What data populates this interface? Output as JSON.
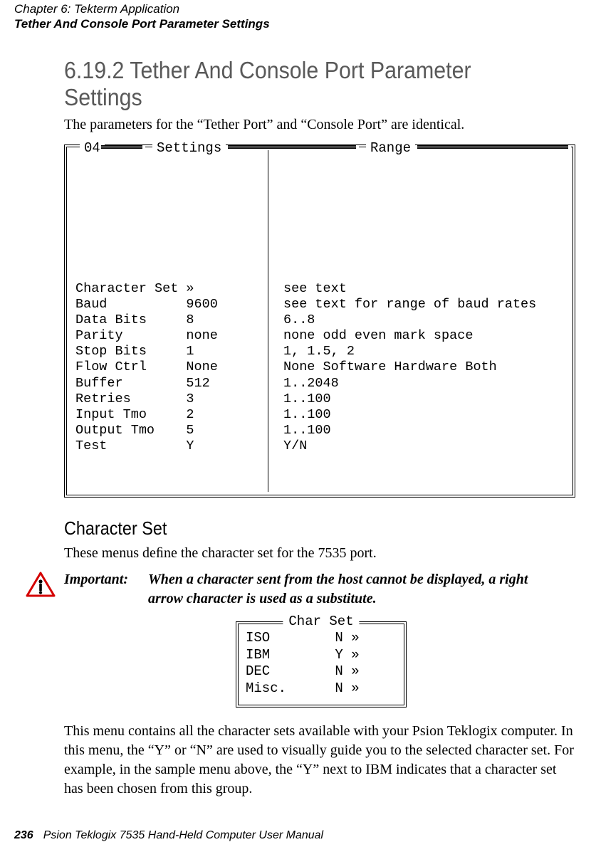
{
  "header": {
    "chapter": "Chapter 6: Tekterm Application",
    "section": "Tether And Console Port Parameter Settings"
  },
  "h2": "6.19.2  Tether And Console Port Parameter Settings",
  "intro": "The parameters for the “Tether Port” and “Console Port” are identical.",
  "settings": {
    "legend04": "04",
    "legendSettings": "Settings",
    "legendRange": "Range",
    "rows": [
      {
        "name": "Character Set",
        "value": "»",
        "range": "see text"
      },
      {
        "name": "Baud",
        "value": "9600",
        "range": "see text for range of baud rates"
      },
      {
        "name": "Data Bits",
        "value": "8",
        "range": "6..8"
      },
      {
        "name": "Parity",
        "value": "none",
        "range": "none odd even mark space"
      },
      {
        "name": "Stop Bits",
        "value": "1",
        "range": "1, 1.5, 2"
      },
      {
        "name": "Flow Ctrl",
        "value": "None",
        "range": "None Software Hardware Both"
      },
      {
        "name": "Buffer",
        "value": "512",
        "range": "1..2048"
      },
      {
        "name": "Retries",
        "value": "3",
        "range": "1..100"
      },
      {
        "name": "Input Tmo",
        "value": "2",
        "range": "1..100"
      },
      {
        "name": "Output Tmo",
        "value": "5",
        "range": "1..100"
      },
      {
        "name": "Test",
        "value": "Y",
        "range": "Y/N"
      }
    ]
  },
  "h3": "Character Set",
  "charsetIntro": "These menus deﬁne the character set for the 7535 port.",
  "important": {
    "label": "Important:",
    "text": "When a character sent from the host cannot be displayed, a right arrow character is used as a substitute."
  },
  "charset": {
    "legend": "Char Set",
    "rows": [
      {
        "name": "ISO",
        "value": "N",
        "arrow": "»"
      },
      {
        "name": "IBM",
        "value": "Y",
        "arrow": "»"
      },
      {
        "name": "DEC",
        "value": "N",
        "arrow": "»"
      },
      {
        "name": "Misc.",
        "value": "N",
        "arrow": "»"
      }
    ]
  },
  "closing": "This menu contains all the character sets available with your Psion Teklogix computer. In this menu, the “Y” or “N” are used to visually guide you to the selected character set. For example, in the sample menu above, the “Y” next to IBM indicates that a character set has been chosen from this group.",
  "footer": {
    "page": "236",
    "title": "Psion Teklogix 7535 Hand-Held Computer User Manual"
  }
}
